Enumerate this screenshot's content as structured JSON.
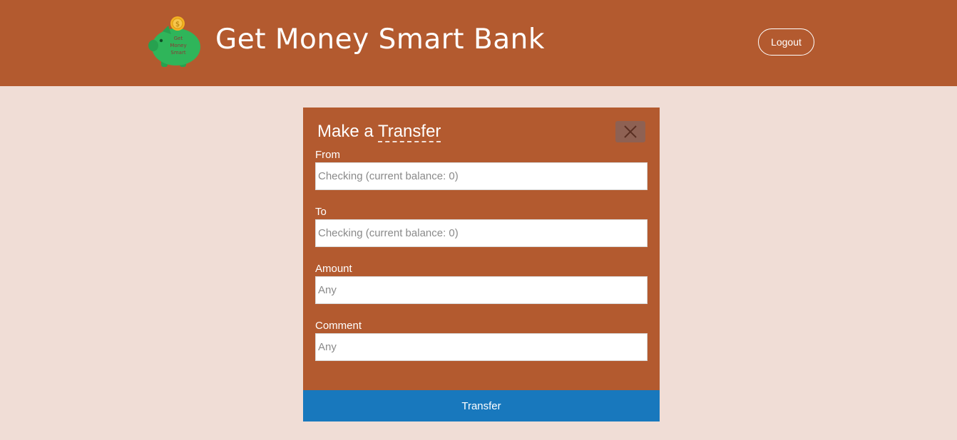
{
  "header": {
    "title": "Get Money Smart Bank",
    "logo_text": [
      "Get",
      "Money",
      "Smart"
    ],
    "logo_coin_symbol": "$",
    "logout_label": "Logout"
  },
  "modal": {
    "title_prefix": "Make a ",
    "title_emphasis": "Transfer",
    "close_icon": "close-icon",
    "fields": [
      {
        "label": "From",
        "placeholder": "Checking (current balance: 0)"
      },
      {
        "label": "To",
        "placeholder": "Checking (current balance: 0)"
      },
      {
        "label": "Amount",
        "placeholder": "Any"
      },
      {
        "label": "Comment",
        "placeholder": "Any"
      }
    ],
    "submit_label": "Transfer"
  },
  "colors": {
    "brand": "#b35a2f",
    "background": "#f0ddd6",
    "primary_button": "#1878bd",
    "close_button": "#8e6153",
    "logo_pig": "#2fb55a",
    "logo_coin": "#f4b223"
  }
}
